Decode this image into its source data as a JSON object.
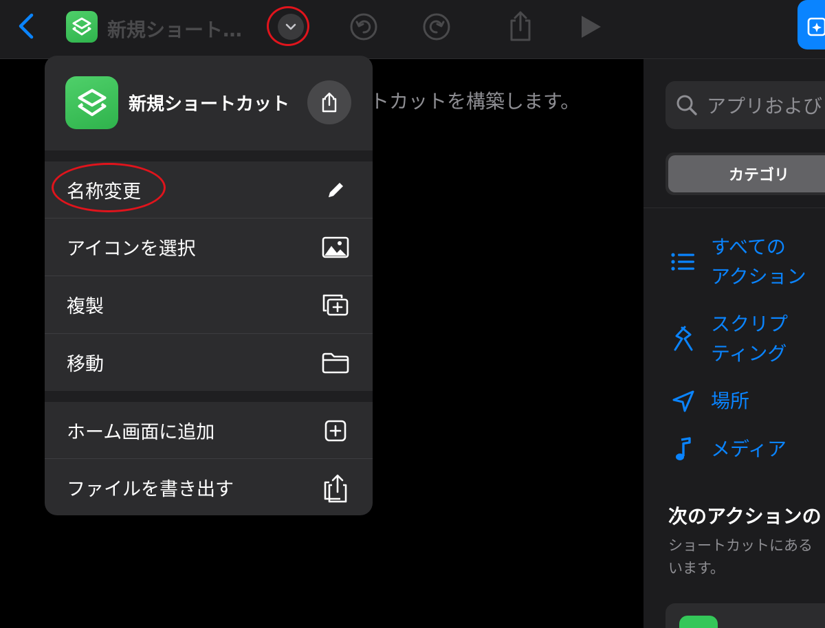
{
  "toolbar": {
    "doc_title": "新規ショート…",
    "icons": [
      "chevron-left-icon",
      "shortcuts-app-icon",
      "chevron-down-icon",
      "undo-icon",
      "redo-icon",
      "share-icon",
      "play-icon"
    ]
  },
  "canvas": {
    "hint": "トカットを構築します。"
  },
  "menu": {
    "title": "新規ショートカット",
    "items": [
      {
        "label": "名称変更",
        "icon": "pencil-icon"
      },
      {
        "label": "アイコンを選択",
        "icon": "photo-icon"
      },
      {
        "label": "複製",
        "icon": "duplicate-icon"
      },
      {
        "label": "移動",
        "icon": "folder-icon"
      },
      {
        "label": "ホーム画面に追加",
        "icon": "plus-square-icon"
      },
      {
        "label": "ファイルを書き出す",
        "icon": "export-icon"
      }
    ]
  },
  "right_panel": {
    "search_placeholder": "アプリおよび",
    "segment_label": "カテゴリ",
    "categories": [
      {
        "label": "すべての\nアクション",
        "icon": "list-icon"
      },
      {
        "label": "スクリプ\nティング",
        "icon": "scripting-icon"
      },
      {
        "label": "場所",
        "icon": "location-arrow-icon"
      },
      {
        "label": "メディア",
        "icon": "music-note-icon"
      }
    ],
    "next_actions_title": "次のアクションの",
    "next_actions_desc": "ショートカットにある\nいます。"
  },
  "colors": {
    "accent": "#0a84ff",
    "highlight_ring": "#e0141c",
    "app_green": "#34c759"
  }
}
